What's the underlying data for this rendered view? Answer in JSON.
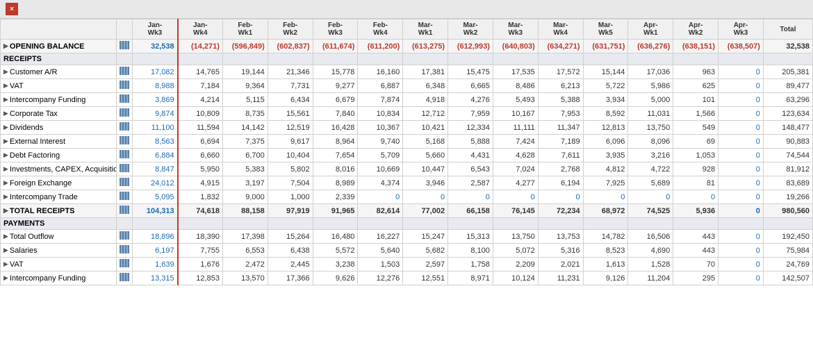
{
  "toolbar": {
    "close_icon": "×"
  },
  "header": {
    "col_label": "",
    "col_icon": "",
    "weeks": [
      {
        "label": "Jan-\nWk3",
        "id": "jan_wk3"
      },
      {
        "label": "Jan-\nWk4",
        "id": "jan_wk4"
      },
      {
        "label": "Feb-\nWk1",
        "id": "feb_wk1"
      },
      {
        "label": "Feb-\nWk2",
        "id": "feb_wk2"
      },
      {
        "label": "Feb-\nWk3",
        "id": "feb_wk3"
      },
      {
        "label": "Feb-\nWk4",
        "id": "feb_wk4"
      },
      {
        "label": "Mar-\nWk1",
        "id": "mar_wk1"
      },
      {
        "label": "Mar-\nWk2",
        "id": "mar_wk2"
      },
      {
        "label": "Mar-\nWk3",
        "id": "mar_wk3"
      },
      {
        "label": "Mar-\nWk4",
        "id": "mar_wk4"
      },
      {
        "label": "Mar-\nWk5",
        "id": "mar_wk5"
      },
      {
        "label": "Apr-\nWk1",
        "id": "apr_wk1"
      },
      {
        "label": "Apr-\nWk2",
        "id": "apr_wk2"
      },
      {
        "label": "Apr-\nWk3",
        "id": "apr_wk3"
      },
      {
        "label": "Total",
        "id": "total"
      }
    ]
  },
  "rows": {
    "opening_balance": {
      "label": "OPENING BALANCE",
      "values": [
        "32,538",
        "(14,271)",
        "(596,849)",
        "(602,837)",
        "(611,674)",
        "(611,200)",
        "(613,275)",
        "(612,993)",
        "(640,803)",
        "(634,271)",
        "(631,751)",
        "(636,276)",
        "(638,151)",
        "(638,507)",
        "32,538"
      ]
    },
    "receipts_header": "RECEIPTS",
    "receipts": [
      {
        "label": "Customer A/R",
        "values": [
          "17,082",
          "14,765",
          "19,144",
          "21,346",
          "15,778",
          "16,160",
          "17,381",
          "15,475",
          "17,535",
          "17,572",
          "15,144",
          "17,036",
          "963",
          "0",
          "205,381"
        ]
      },
      {
        "label": "VAT",
        "values": [
          "8,988",
          "7,184",
          "9,364",
          "7,731",
          "9,277",
          "6,887",
          "6,348",
          "6,665",
          "8,486",
          "6,213",
          "5,722",
          "5,986",
          "625",
          "0",
          "89,477"
        ]
      },
      {
        "label": "Intercompany Funding",
        "values": [
          "3,869",
          "4,214",
          "5,115",
          "6,434",
          "6,679",
          "7,874",
          "4,918",
          "4,276",
          "5,493",
          "5,388",
          "3,934",
          "5,000",
          "101",
          "0",
          "63,296"
        ]
      },
      {
        "label": "Corporate Tax",
        "values": [
          "9,874",
          "10,809",
          "8,735",
          "15,561",
          "7,840",
          "10,834",
          "12,712",
          "7,959",
          "10,167",
          "7,953",
          "8,592",
          "11,031",
          "1,566",
          "0",
          "123,634"
        ]
      },
      {
        "label": "Dividends",
        "values": [
          "11,100",
          "11,594",
          "14,142",
          "12,519",
          "16,428",
          "10,367",
          "10,421",
          "12,334",
          "11,111",
          "11,347",
          "12,813",
          "13,750",
          "549",
          "0",
          "148,477"
        ]
      },
      {
        "label": "External Interest",
        "values": [
          "8,563",
          "6,694",
          "7,375",
          "9,617",
          "8,964",
          "9,740",
          "5,168",
          "5,888",
          "7,424",
          "7,189",
          "6,096",
          "8,096",
          "69",
          "0",
          "90,883"
        ]
      },
      {
        "label": "Debt Factoring",
        "values": [
          "6,884",
          "6,660",
          "6,700",
          "10,404",
          "7,654",
          "5,709",
          "5,660",
          "4,431",
          "4,628",
          "7,611",
          "3,935",
          "3,216",
          "1,053",
          "0",
          "74,544"
        ]
      },
      {
        "label": "Investments, CAPEX, Acquisition",
        "values": [
          "8,847",
          "5,950",
          "5,383",
          "5,802",
          "8,016",
          "10,669",
          "10,447",
          "6,543",
          "7,024",
          "2,768",
          "4,812",
          "4,722",
          "928",
          "0",
          "81,912"
        ]
      },
      {
        "label": "Foreign Exchange",
        "values": [
          "24,012",
          "4,915",
          "3,197",
          "7,504",
          "8,989",
          "4,374",
          "3,946",
          "2,587",
          "4,277",
          "6,194",
          "7,925",
          "5,689",
          "81",
          "0",
          "83,689"
        ]
      },
      {
        "label": "Intercompany Trade",
        "values": [
          "5,095",
          "1,832",
          "9,000",
          "1,000",
          "2,339",
          "0",
          "0",
          "0",
          "0",
          "0",
          "0",
          "0",
          "0",
          "0",
          "19,266"
        ]
      }
    ],
    "total_receipts": {
      "label": "TOTAL RECEIPTS",
      "values": [
        "104,313",
        "74,618",
        "88,158",
        "97,919",
        "91,965",
        "82,614",
        "77,002",
        "66,158",
        "76,145",
        "72,234",
        "68,972",
        "74,525",
        "5,936",
        "0",
        "980,560"
      ]
    },
    "payments_header": "PAYMENTS",
    "payments": [
      {
        "label": "Total Outflow",
        "values": [
          "18,896",
          "18,390",
          "17,398",
          "15,264",
          "16,480",
          "16,227",
          "15,247",
          "15,313",
          "13,750",
          "13,753",
          "14,782",
          "16,506",
          "443",
          "0",
          "192,450"
        ]
      },
      {
        "label": "Salaries",
        "values": [
          "6,197",
          "7,755",
          "6,553",
          "6,438",
          "5,572",
          "5,640",
          "5,682",
          "8,100",
          "5,072",
          "5,316",
          "8,523",
          "4,690",
          "443",
          "0",
          "75,984"
        ]
      },
      {
        "label": "VAT",
        "values": [
          "1,639",
          "1,676",
          "2,472",
          "2,445",
          "3,238",
          "1,503",
          "2,597",
          "1,758",
          "2,209",
          "2,021",
          "1,613",
          "1,528",
          "70",
          "0",
          "24,769"
        ]
      },
      {
        "label": "Intercompany Funding",
        "values": [
          "13,315",
          "12,853",
          "13,570",
          "17,366",
          "9,626",
          "12,276",
          "12,551",
          "8,971",
          "10,124",
          "11,231",
          "9,126",
          "11,204",
          "295",
          "0",
          "142,507"
        ]
      }
    ]
  },
  "colors": {
    "blue": "#1a6ab5",
    "red": "#c0392b",
    "black": "#333333",
    "zero": "#1a6ab5",
    "section_bg": "#e8eaf0",
    "total_bg": "#f5f5f5"
  }
}
